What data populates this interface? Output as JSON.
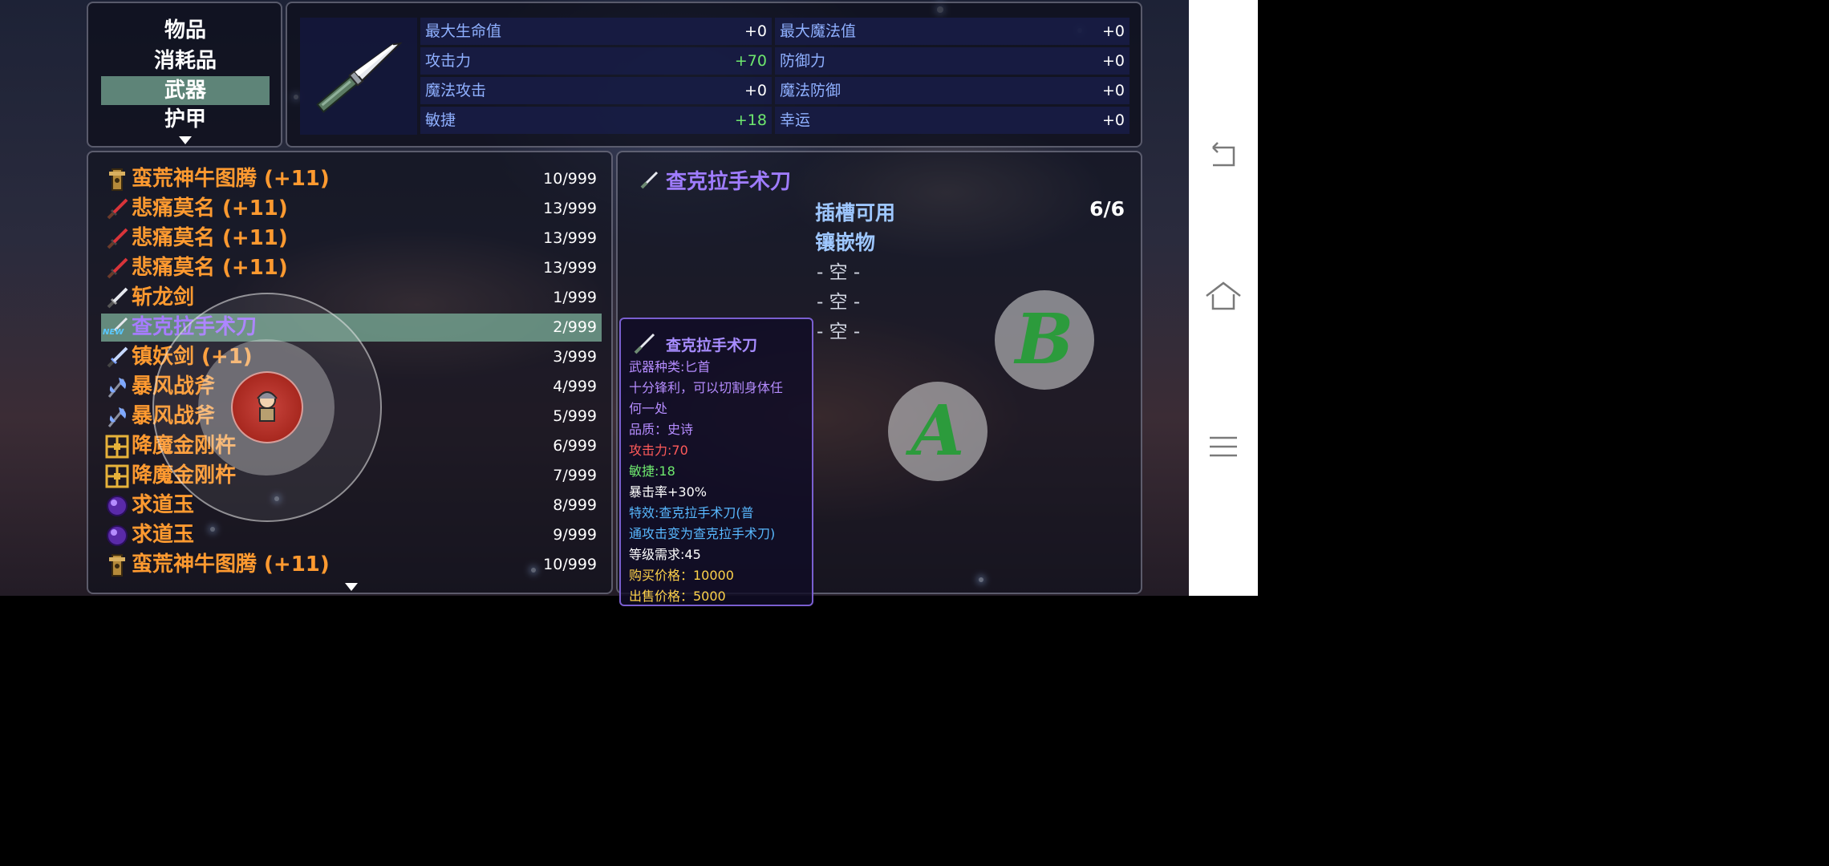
{
  "categories": {
    "items": [
      {
        "label": "物品",
        "selected": false
      },
      {
        "label": "消耗品",
        "selected": false
      },
      {
        "label": "武器",
        "selected": true
      },
      {
        "label": "护甲",
        "selected": false
      }
    ],
    "more_icon": "triangle-down-icon"
  },
  "stats": [
    {
      "label": "最大生命值",
      "value": "+0"
    },
    {
      "label": "最大魔法值",
      "value": "+0"
    },
    {
      "label": "攻击力",
      "value": "+70"
    },
    {
      "label": "防御力",
      "value": "+0"
    },
    {
      "label": "魔法攻击",
      "value": "+0"
    },
    {
      "label": "魔法防御",
      "value": "+0"
    },
    {
      "label": "敏捷",
      "value": "+18"
    },
    {
      "label": "幸运",
      "value": "+0"
    }
  ],
  "items": [
    {
      "name": "蛮荒神牛图腾 (+11)",
      "count": "10/999",
      "icon": "totem-icon"
    },
    {
      "name": "悲痛莫名 (+11)",
      "count": "13/999",
      "icon": "red-sword-icon"
    },
    {
      "name": "悲痛莫名 (+11)",
      "count": "13/999",
      "icon": "red-sword-icon"
    },
    {
      "name": "悲痛莫名 (+11)",
      "count": "13/999",
      "icon": "red-sword-icon"
    },
    {
      "name": "斩龙剑",
      "count": "1/999",
      "icon": "sword-icon"
    },
    {
      "name": "查克拉手术刀",
      "count": "2/999",
      "icon": "scalpel-icon",
      "selected": true,
      "badge": "NEW"
    },
    {
      "name": "镇妖剑 (+1)",
      "count": "3/999",
      "icon": "blue-sword-icon"
    },
    {
      "name": "暴风战斧",
      "count": "4/999",
      "icon": "axe-icon"
    },
    {
      "name": "暴风战斧",
      "count": "5/999",
      "icon": "axe-icon"
    },
    {
      "name": "降魔金刚杵",
      "count": "6/999",
      "icon": "vajra-icon"
    },
    {
      "name": "降魔金刚杵",
      "count": "7/999",
      "icon": "vajra-icon"
    },
    {
      "name": "求道玉",
      "count": "8/999",
      "icon": "orb-icon"
    },
    {
      "name": "求道玉",
      "count": "9/999",
      "icon": "orb-icon"
    },
    {
      "name": "蛮荒神牛图腾 (+11)",
      "count": "10/999",
      "icon": "totem-icon"
    }
  ],
  "detail": {
    "title": "查克拉手术刀",
    "slots_label": "插槽可用",
    "slots_value": "6/6",
    "inlay_label": "镶嵌物",
    "sockets": [
      "- 空 -",
      "- 空 -",
      "- 空 -"
    ]
  },
  "tooltip": {
    "title": "查克拉手术刀",
    "lines": [
      {
        "text": "武器种类:匕首",
        "color": "#b58cff"
      },
      {
        "text": "十分锋利，可以切割身体任",
        "color": "#b58cff"
      },
      {
        "text": "何一处",
        "color": "#b58cff"
      },
      {
        "text": "品质：史诗",
        "color": "#b58cff"
      },
      {
        "text": "攻击力:70",
        "color": "#ff5a5a"
      },
      {
        "text": "敏捷:18",
        "color": "#6ee86e"
      },
      {
        "text": "暴击率+30%",
        "color": "#ffffff"
      },
      {
        "text": "特效:查克拉手术刀(普",
        "color": "#58b8ff"
      },
      {
        "text": "通攻击变为查克拉手术刀)",
        "color": "#58b8ff"
      },
      {
        "text": "等级需求:45",
        "color": "#ffffff"
      },
      {
        "text": "购买价格：10000",
        "color": "#ffd34a"
      },
      {
        "text": "出售价格：5000",
        "color": "#ffd34a"
      }
    ]
  },
  "controls": {
    "button_a": "A",
    "button_b": "B"
  },
  "system_nav": {
    "back_icon": "back-icon",
    "home_icon": "home-icon",
    "menu_icon": "menu-icon"
  }
}
